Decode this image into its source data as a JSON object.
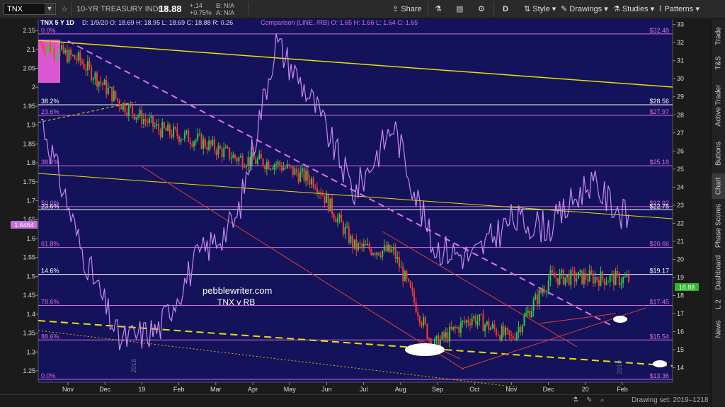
{
  "toolbar": {
    "symbol": "TNX",
    "star": "☆",
    "description": "10-YR TREASURY INDEX",
    "last": "18.88",
    "change": "+.14",
    "change_pct": "+0.75%",
    "bid": "B: N/A",
    "ask": "A: N/A",
    "share_label": "Share",
    "period_label": "D",
    "style_label": "Style",
    "drawings_label": "Drawings",
    "studies_label": "Studies",
    "patterns_label": "Patterns"
  },
  "header": {
    "title": "TNX 5 Y 1D",
    "info": "D: 1/9/20  O: 18.69  H: 18.95  L: 18.69  C: 18.88  R: 0.26",
    "comparison": "Comparison (LINE, /RB)  O: 1.65  H: 1.66  L: 1.64  C: 1.65"
  },
  "right_tabs": [
    "Trade",
    "T&S",
    "Active Trader",
    "Buttons",
    "Chart",
    "Phase Scores",
    "Dashboard",
    "L 2",
    "News"
  ],
  "left_axis": {
    "ticks": [
      "2.15",
      "2.1",
      "2.05",
      "2",
      "1.95",
      "1.9",
      "1.85",
      "1.8",
      "1.75",
      "1.7",
      "1.65",
      "1.6",
      "1.55",
      "1.5",
      "1.45",
      "1.4",
      "1.35",
      "1.3",
      "1.25"
    ],
    "current_label": "1.6464"
  },
  "right_axis": {
    "ticks": [
      "33",
      "32",
      "31",
      "30",
      "29",
      "28",
      "27",
      "26",
      "25",
      "24",
      "23",
      "22",
      "21",
      "20",
      "19",
      "18",
      "17",
      "16",
      "15",
      "14"
    ],
    "current_label": "18.88"
  },
  "x_axis": {
    "ticks": [
      "Nov",
      "Dec",
      "19",
      "Feb",
      "Mar",
      "Apr",
      "May",
      "Jun",
      "Jul",
      "Aug",
      "Sep",
      "Oct",
      "Nov",
      "Dec",
      "20",
      "Feb"
    ]
  },
  "fib_levels": [
    {
      "left": "0.0%",
      "right": "$32.48"
    },
    {
      "left": "38.2%",
      "right": "$28.56"
    },
    {
      "left": "23.6%",
      "right": "$27.97"
    },
    {
      "left": "38.2%",
      "right": "$25.18"
    },
    {
      "left": "50.0%",
      "right": "$22.92"
    },
    {
      "left": "23.6%",
      "right": "$22.75"
    },
    {
      "left": "61.8%",
      "right": "$20.66"
    },
    {
      "left": "14.6%",
      "right": "$19.17"
    },
    {
      "left": "78.6%",
      "right": "$17.45"
    },
    {
      "left": "88.6%",
      "right": "$15.54"
    },
    {
      "left": "0.0%",
      "right": "$13.36"
    }
  ],
  "annotation": {
    "line1": "pebblewriter.com",
    "line2": "TNX v RB"
  },
  "watermarks": [
    "2018",
    "2019"
  ],
  "bottom": {
    "drawing_set": "Drawing set: 2019–1218"
  },
  "colors": {
    "chart_bg": "#14125a",
    "up": "#2ecc40",
    "down": "#ff3b30",
    "comparison": "#c58bf0",
    "fib": "#d070e0",
    "yellow": "#e8e000",
    "red_line": "#e0403a",
    "dashed_violet": "#e070f0"
  },
  "chart_data": {
    "type": "candlestick+line",
    "title": "TNX 5 Y 1D",
    "left_ylim": [
      1.22,
      2.18
    ],
    "right_ylim": [
      13.2,
      33.3
    ],
    "primary_series": {
      "name": "TNX",
      "axis": "right",
      "x": [
        "2018-10",
        "2018-11",
        "2018-12",
        "2019-01",
        "2019-02",
        "2019-03",
        "2019-04",
        "2019-05",
        "2019-06",
        "2019-07",
        "2019-08",
        "2019-09",
        "2019-10",
        "2019-11",
        "2019-12",
        "2020-01"
      ],
      "close": [
        31.9,
        31.0,
        28.7,
        27.2,
        26.6,
        25.6,
        25.3,
        24.3,
        20.7,
        20.4,
        15.2,
        16.8,
        15.6,
        19.0,
        19.0,
        18.88
      ]
    },
    "comparison_series": {
      "name": "Comparison (LINE, /RB)",
      "axis": "left",
      "x": [
        "2018-10",
        "2018-11",
        "2018-12",
        "2019-01",
        "2019-02",
        "2019-03",
        "2019-04",
        "2019-05",
        "2019-06",
        "2019-07",
        "2019-08",
        "2019-09",
        "2019-10",
        "2019-11",
        "2019-12",
        "2020-01"
      ],
      "values": [
        1.92,
        1.58,
        1.33,
        1.36,
        1.55,
        1.65,
        2.12,
        1.95,
        1.72,
        1.9,
        1.58,
        1.55,
        1.65,
        1.63,
        1.75,
        1.65
      ]
    }
  }
}
